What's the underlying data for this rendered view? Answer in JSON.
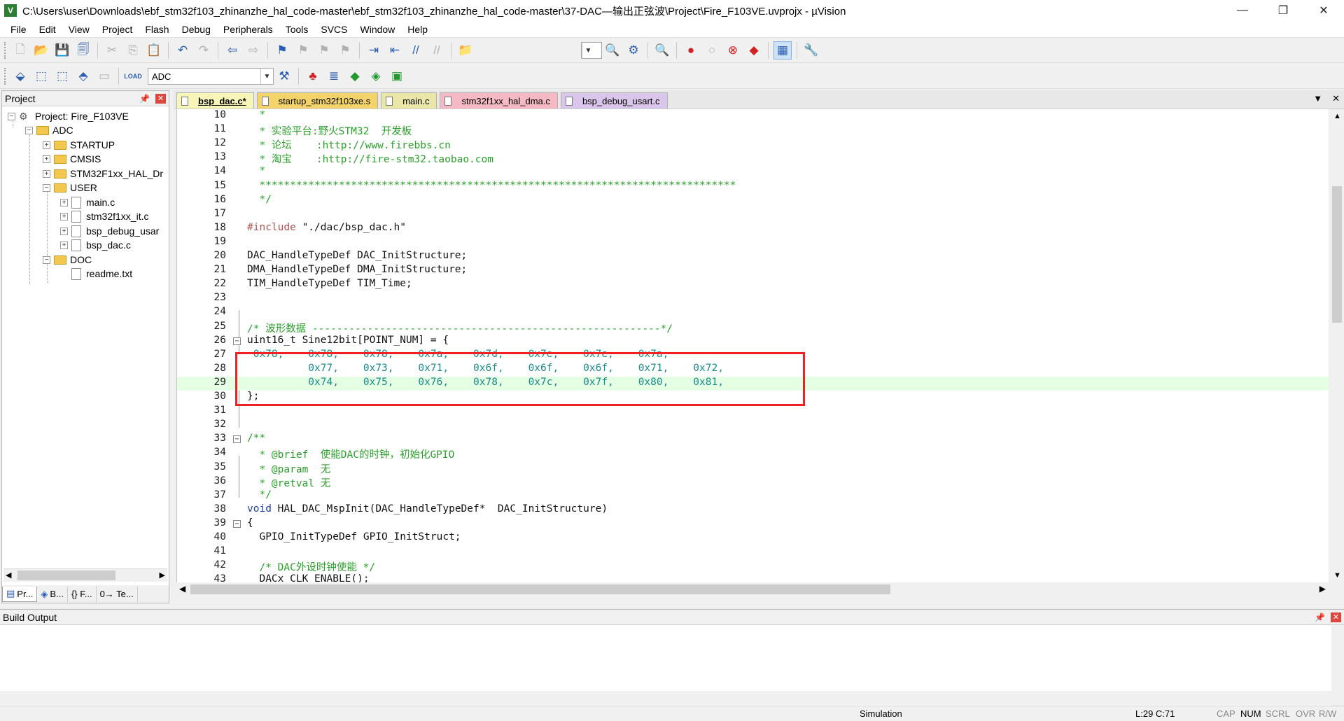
{
  "window": {
    "title": "C:\\Users\\user\\Downloads\\ebf_stm32f103_zhinanzhe_hal_code-master\\ebf_stm32f103_zhinanzhe_hal_code-master\\37-DAC—输出正弦波\\Project\\Fire_F103VE.uvprojx - µVision",
    "minimize": "—",
    "maximize": "❐",
    "close": "✕"
  },
  "menu": [
    "File",
    "Edit",
    "View",
    "Project",
    "Flash",
    "Debug",
    "Peripherals",
    "Tools",
    "SVCS",
    "Window",
    "Help"
  ],
  "toolbar2": {
    "target": "ADC",
    "load_label": "LOAD"
  },
  "project_panel": {
    "title": "Project",
    "tree": {
      "project": "Project: Fire_F103VE",
      "target": "ADC",
      "groups": [
        "STARTUP",
        "CMSIS",
        "STM32F1xx_HAL_Dr",
        "USER"
      ],
      "user_files": [
        "main.c",
        "stm32f1xx_it.c",
        "bsp_debug_usar",
        "bsp_dac.c"
      ],
      "doc_group": "DOC",
      "doc_files": [
        "readme.txt"
      ]
    },
    "tabs": [
      "Pr...",
      "B...",
      "{} F...",
      "0→ Te..."
    ]
  },
  "editor": {
    "tabs": [
      {
        "label": "bsp_dac.c*",
        "color": "#f7f5b8",
        "active": true
      },
      {
        "label": "startup_stm32f103xe.s",
        "color": "#f4d36a",
        "active": false
      },
      {
        "label": "main.c",
        "color": "#e9e6a8",
        "active": false
      },
      {
        "label": "stm32f1xx_hal_dma.c",
        "color": "#f4b9c2",
        "active": false
      },
      {
        "label": "bsp_debug_usart.c",
        "color": "#d9c6ea",
        "active": false
      }
    ],
    "tab_menu": "▼",
    "tab_close": "✕",
    "lines": [
      {
        "n": "10",
        "parts": [
          [
            "c-green",
            "  *"
          ]
        ]
      },
      {
        "n": "11",
        "parts": [
          [
            "c-green",
            "  * 实验平台:野火STM32  开发板"
          ]
        ]
      },
      {
        "n": "12",
        "parts": [
          [
            "c-green",
            "  * 论坛    :http://www.firebbs.cn"
          ]
        ]
      },
      {
        "n": "13",
        "parts": [
          [
            "c-green",
            "  * 淘宝    :http://fire-stm32.taobao.com"
          ]
        ]
      },
      {
        "n": "14",
        "parts": [
          [
            "c-green",
            "  *"
          ]
        ]
      },
      {
        "n": "15",
        "parts": [
          [
            "c-green",
            "  ******************************************************************************"
          ]
        ]
      },
      {
        "n": "16",
        "parts": [
          [
            "c-green",
            "  */"
          ]
        ]
      },
      {
        "n": "17",
        "parts": []
      },
      {
        "n": "18",
        "parts": [
          [
            "c-pre",
            "#include "
          ],
          [
            "c-black",
            "\"./dac/bsp_dac.h\""
          ]
        ]
      },
      {
        "n": "19",
        "parts": []
      },
      {
        "n": "20",
        "parts": [
          [
            "c-black",
            "DAC_HandleTypeDef DAC_InitStructure;"
          ]
        ]
      },
      {
        "n": "21",
        "parts": [
          [
            "c-black",
            "DMA_HandleTypeDef DMA_InitStructure;"
          ]
        ]
      },
      {
        "n": "22",
        "parts": [
          [
            "c-black",
            "TIM_HandleTypeDef TIM_Time;"
          ]
        ]
      },
      {
        "n": "23",
        "parts": []
      },
      {
        "n": "24",
        "parts": []
      },
      {
        "n": "25",
        "parts": [
          [
            "c-green",
            "/* 波形数据 ---------------------------------------------------------*/"
          ]
        ]
      },
      {
        "n": "26",
        "parts": [
          [
            "c-black",
            "uint16_t Sine12bit[POINT_NUM] = {"
          ]
        ],
        "fold": "−"
      },
      {
        "n": "27",
        "parts": [
          [
            "c-teal",
            " 0x78,    0x78,    0x78,    0x7a,    0x7d,    0x7e,    0x7e,    0x7a,"
          ]
        ]
      },
      {
        "n": "28",
        "parts": [
          [
            "c-teal",
            "          0x77,    0x73,    0x71,    0x6f,    0x6f,    0x6f,    0x71,    0x72,"
          ]
        ]
      },
      {
        "n": "29",
        "parts": [
          [
            "c-teal",
            "          0x74,    0x75,    0x76,    0x78,    0x7c,    0x7f,    0x80,    0x81,"
          ]
        ],
        "hl": true
      },
      {
        "n": "30",
        "parts": [
          [
            "c-black",
            "};"
          ]
        ]
      },
      {
        "n": "31",
        "parts": []
      },
      {
        "n": "32",
        "parts": []
      },
      {
        "n": "33",
        "parts": [
          [
            "c-green",
            "/**"
          ]
        ],
        "fold": "−"
      },
      {
        "n": "34",
        "parts": [
          [
            "c-green",
            "  * @brief  使能DAC的时钟，初始化GPIO"
          ]
        ]
      },
      {
        "n": "35",
        "parts": [
          [
            "c-green",
            "  * @param  无"
          ]
        ]
      },
      {
        "n": "36",
        "parts": [
          [
            "c-green",
            "  * @retval 无"
          ]
        ]
      },
      {
        "n": "37",
        "parts": [
          [
            "c-green",
            "  */"
          ]
        ]
      },
      {
        "n": "38",
        "parts": [
          [
            "c-kw",
            "void "
          ],
          [
            "c-black",
            "HAL_DAC_MspInit(DAC_HandleTypeDef*  DAC_InitStructure)"
          ]
        ]
      },
      {
        "n": "39",
        "parts": [
          [
            "c-black",
            "{"
          ]
        ],
        "fold": "−"
      },
      {
        "n": "40",
        "parts": [
          [
            "c-black",
            "  GPIO_InitTypeDef GPIO_InitStruct;"
          ]
        ]
      },
      {
        "n": "41",
        "parts": []
      },
      {
        "n": "42",
        "parts": [
          [
            "c-green",
            "  /* DAC外设时钟使能 */"
          ]
        ]
      },
      {
        "n": "43",
        "parts": [
          [
            "c-black",
            "  DACx_CLK_ENABLE();"
          ]
        ]
      }
    ]
  },
  "build_output": {
    "title": "Build Output"
  },
  "statusbar": {
    "mode": "Simulation",
    "position": "L:29 C:71",
    "cap": "CAP",
    "num": "NUM",
    "scrl": "SCRL",
    "ovr": "OVR",
    "rw": "R/W"
  }
}
